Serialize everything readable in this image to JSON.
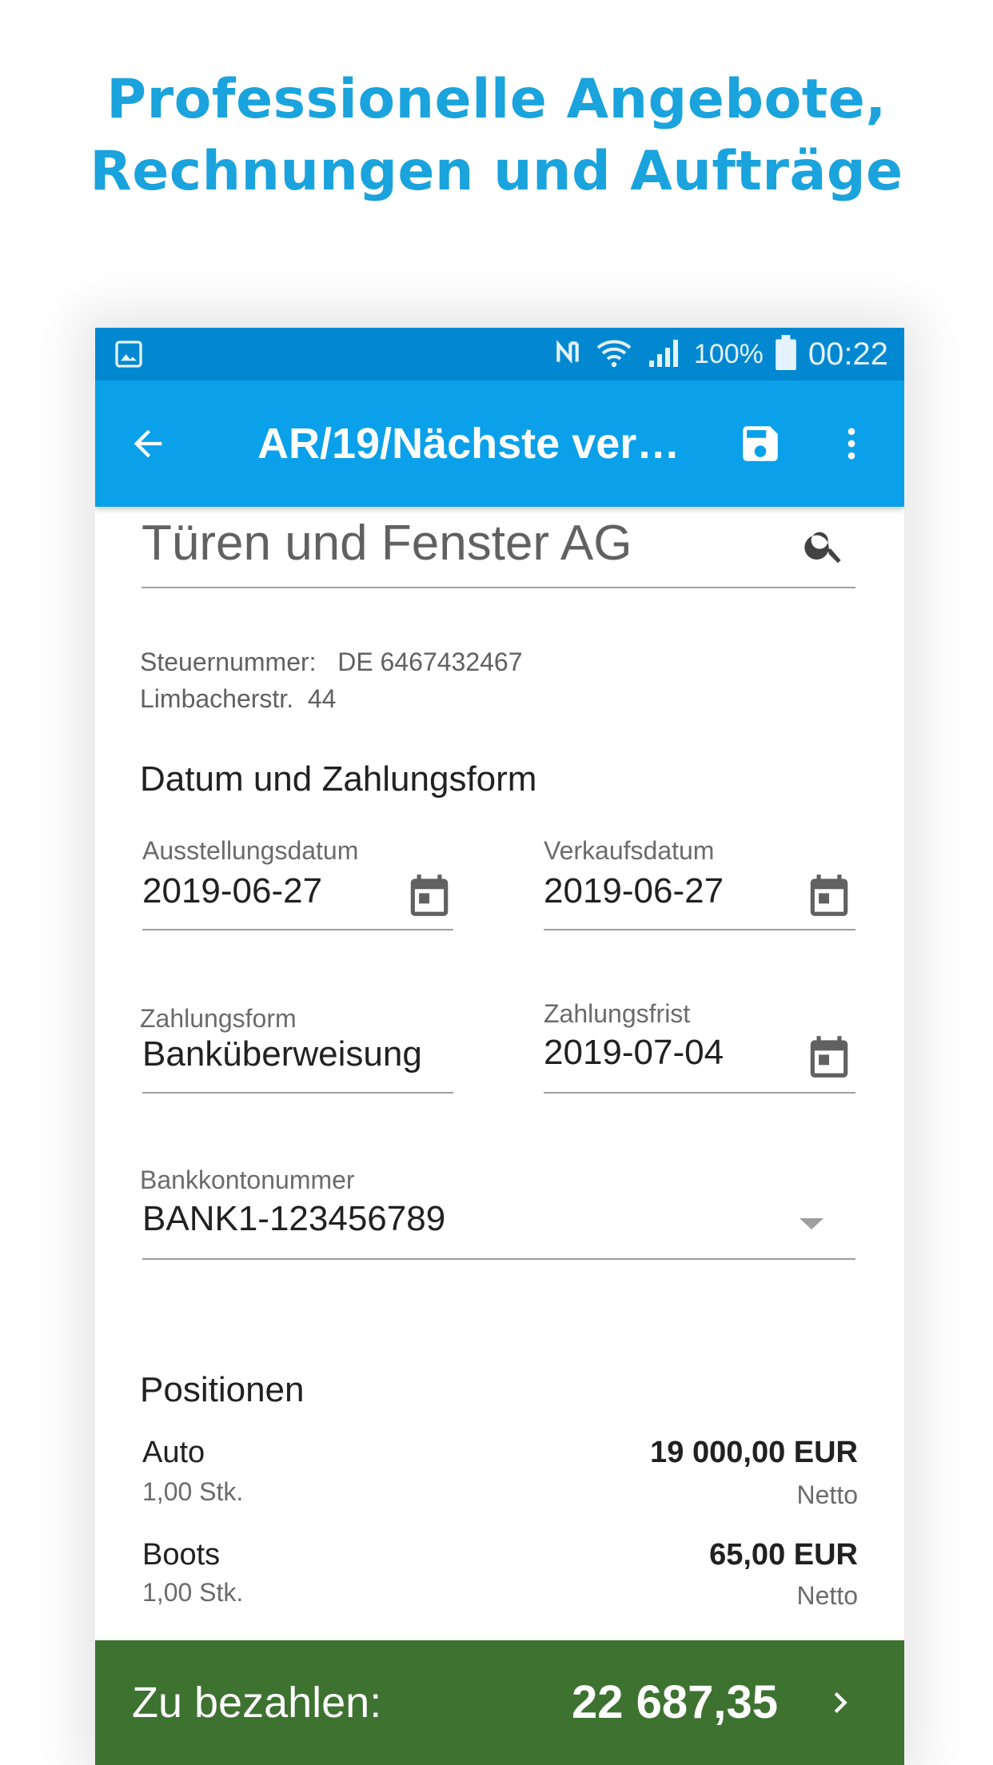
{
  "headline": {
    "line1": "Professionelle Angebote,",
    "line2": "Rechnungen und Aufträge",
    "color": "#1aa3dc"
  },
  "statusbar": {
    "battery": "100%",
    "time": "00:22",
    "icons": [
      "image-icon",
      "nfc-icon",
      "wifi-icon",
      "signal-icon",
      "battery-icon"
    ]
  },
  "appbar": {
    "title": "AR/19/Nächste ver…",
    "color": "#0aa0ea",
    "icons": [
      "back-arrow-icon",
      "save-icon",
      "more-vert-icon"
    ]
  },
  "customer": {
    "name": "Türen und Fenster AG",
    "tax_label": "Steuernummer:",
    "tax_value": "DE 6467432467",
    "street": "Limbacherstr.",
    "street_no": "44"
  },
  "section_date": "Datum und Zahlungsform",
  "fields": {
    "issue_date_label": "Ausstellungsdatum",
    "issue_date": "2019-06-27",
    "sale_date_label": "Verkaufsdatum",
    "sale_date": "2019-06-27",
    "payment_form_label": "Zahlungsform",
    "payment_form": "Banküberweisung",
    "payment_due_label": "Zahlungsfrist",
    "payment_due": "2019-07-04",
    "bank_account_label": "Bankkontonummer",
    "bank_account": "BANK1-123456789"
  },
  "section_positions": "Positionen",
  "positions": [
    {
      "name": "Auto",
      "qty": "1,00 Stk.",
      "amount": "19 000,00 EUR",
      "net": "Netto"
    },
    {
      "name": "Boots",
      "qty": "1,00 Stk.",
      "amount": "65,00 EUR",
      "net": "Netto"
    }
  ],
  "total": {
    "label": "Zu bezahlen:",
    "value": "22 687,35",
    "color": "#3d7230"
  }
}
